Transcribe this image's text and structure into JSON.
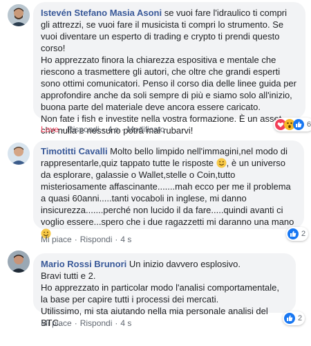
{
  "comments": [
    {
      "author": "Istevén Stefano Masia Asoni",
      "text": " se vuoi fare l'idraulico ti compri gli attrezzi, se vuoi fare il musicista ti compri lo strumento. Se vuoi diventare un esperto di trading e crypto ti prendi questo corso!\nHo apprezzato finora la chiarezza espositiva e mentale che riescono a trasmettere gli autori, che oltre che grandi esperti sono ottimi comunicatori. Penso il corso dia delle linee guida per approfondire anche da soli sempre di più e siamo solo all'inizio, buona parte del materiale deve ancora essere caricato.\nNon fate i fish e investite nella vostra formazione. È un asset che nulla e nessuno potrà mai rubarvi!",
      "actions": {
        "like": "Love",
        "reply": "Rispondi",
        "time": "4 s",
        "edited": "Modificato"
      },
      "reaction_count": "6",
      "reactions": [
        "love-reaction-icon",
        "wow-reaction-icon",
        "like-reaction-icon"
      ]
    },
    {
      "author": "Timotitti Cavalli",
      "text_before_emoji": " Molto bello limpido nell'immagini,nel modo di rappresentarle,quiz tappato tutte le risposte ",
      "text_middle": ", è un universo da esplorare, galassie o Wallet,stelle o Coin,tutto misteriosamente affascinante.......mah ecco per me il problema a quasi 60anni.....tanti vocaboli in inglese, mi danno insicurezza.......perché non lucido il da fare.....quindi avanti ci voglio essere...spero che i due ragazzetti mi daranno una mano",
      "actions": {
        "like": "Mi piace",
        "reply": "Rispondi",
        "time": "4 s"
      },
      "reaction_count": "2",
      "reactions": [
        "like-reaction-icon"
      ]
    },
    {
      "author": "Mario Rossi Brunori",
      "text": " Un inizio davvero esplosivo.\nBravi tutti e 2.\nHo apprezzato in particolar modo l'analisi comportamentale, la base per capire tutti i processi dei mercati.\nUtilissimo, mi sta aiutando nella mia personale analisi del BTC.",
      "actions": {
        "like": "Mi piace",
        "reply": "Rispondi",
        "time": "4 s"
      },
      "reaction_count": "2",
      "reactions": [
        "like-reaction-icon"
      ]
    }
  ],
  "colors": {
    "author": "#385898",
    "bubble": "#f2f3f5",
    "meta": "#606770",
    "love": "#f33e58",
    "like": "#1877f2",
    "wow": "#f7b928"
  }
}
